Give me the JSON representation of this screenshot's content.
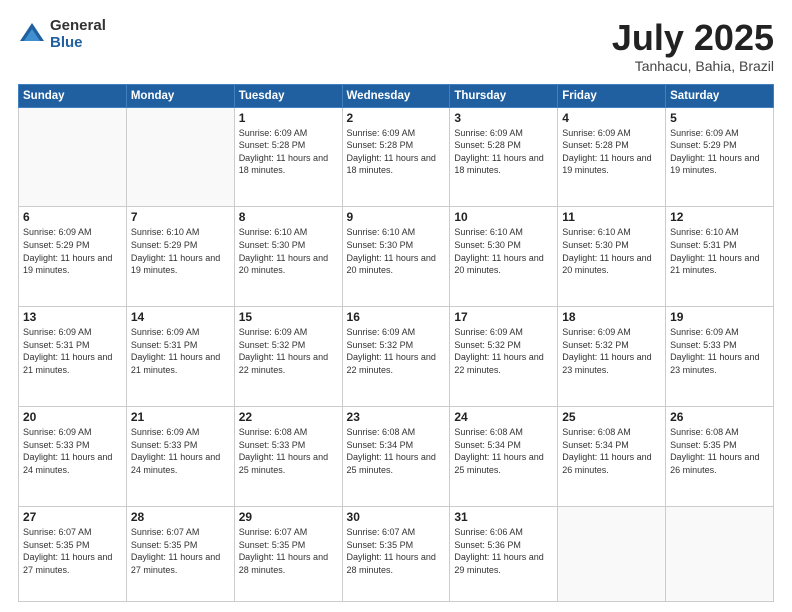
{
  "header": {
    "logo_general": "General",
    "logo_blue": "Blue",
    "month_title": "July 2025",
    "location": "Tanhacu, Bahia, Brazil"
  },
  "weekdays": [
    "Sunday",
    "Monday",
    "Tuesday",
    "Wednesday",
    "Thursday",
    "Friday",
    "Saturday"
  ],
  "weeks": [
    [
      {
        "day": "",
        "info": ""
      },
      {
        "day": "",
        "info": ""
      },
      {
        "day": "1",
        "info": "Sunrise: 6:09 AM\nSunset: 5:28 PM\nDaylight: 11 hours and 18 minutes."
      },
      {
        "day": "2",
        "info": "Sunrise: 6:09 AM\nSunset: 5:28 PM\nDaylight: 11 hours and 18 minutes."
      },
      {
        "day": "3",
        "info": "Sunrise: 6:09 AM\nSunset: 5:28 PM\nDaylight: 11 hours and 18 minutes."
      },
      {
        "day": "4",
        "info": "Sunrise: 6:09 AM\nSunset: 5:28 PM\nDaylight: 11 hours and 19 minutes."
      },
      {
        "day": "5",
        "info": "Sunrise: 6:09 AM\nSunset: 5:29 PM\nDaylight: 11 hours and 19 minutes."
      }
    ],
    [
      {
        "day": "6",
        "info": "Sunrise: 6:09 AM\nSunset: 5:29 PM\nDaylight: 11 hours and 19 minutes."
      },
      {
        "day": "7",
        "info": "Sunrise: 6:10 AM\nSunset: 5:29 PM\nDaylight: 11 hours and 19 minutes."
      },
      {
        "day": "8",
        "info": "Sunrise: 6:10 AM\nSunset: 5:30 PM\nDaylight: 11 hours and 20 minutes."
      },
      {
        "day": "9",
        "info": "Sunrise: 6:10 AM\nSunset: 5:30 PM\nDaylight: 11 hours and 20 minutes."
      },
      {
        "day": "10",
        "info": "Sunrise: 6:10 AM\nSunset: 5:30 PM\nDaylight: 11 hours and 20 minutes."
      },
      {
        "day": "11",
        "info": "Sunrise: 6:10 AM\nSunset: 5:30 PM\nDaylight: 11 hours and 20 minutes."
      },
      {
        "day": "12",
        "info": "Sunrise: 6:10 AM\nSunset: 5:31 PM\nDaylight: 11 hours and 21 minutes."
      }
    ],
    [
      {
        "day": "13",
        "info": "Sunrise: 6:09 AM\nSunset: 5:31 PM\nDaylight: 11 hours and 21 minutes."
      },
      {
        "day": "14",
        "info": "Sunrise: 6:09 AM\nSunset: 5:31 PM\nDaylight: 11 hours and 21 minutes."
      },
      {
        "day": "15",
        "info": "Sunrise: 6:09 AM\nSunset: 5:32 PM\nDaylight: 11 hours and 22 minutes."
      },
      {
        "day": "16",
        "info": "Sunrise: 6:09 AM\nSunset: 5:32 PM\nDaylight: 11 hours and 22 minutes."
      },
      {
        "day": "17",
        "info": "Sunrise: 6:09 AM\nSunset: 5:32 PM\nDaylight: 11 hours and 22 minutes."
      },
      {
        "day": "18",
        "info": "Sunrise: 6:09 AM\nSunset: 5:32 PM\nDaylight: 11 hours and 23 minutes."
      },
      {
        "day": "19",
        "info": "Sunrise: 6:09 AM\nSunset: 5:33 PM\nDaylight: 11 hours and 23 minutes."
      }
    ],
    [
      {
        "day": "20",
        "info": "Sunrise: 6:09 AM\nSunset: 5:33 PM\nDaylight: 11 hours and 24 minutes."
      },
      {
        "day": "21",
        "info": "Sunrise: 6:09 AM\nSunset: 5:33 PM\nDaylight: 11 hours and 24 minutes."
      },
      {
        "day": "22",
        "info": "Sunrise: 6:08 AM\nSunset: 5:33 PM\nDaylight: 11 hours and 25 minutes."
      },
      {
        "day": "23",
        "info": "Sunrise: 6:08 AM\nSunset: 5:34 PM\nDaylight: 11 hours and 25 minutes."
      },
      {
        "day": "24",
        "info": "Sunrise: 6:08 AM\nSunset: 5:34 PM\nDaylight: 11 hours and 25 minutes."
      },
      {
        "day": "25",
        "info": "Sunrise: 6:08 AM\nSunset: 5:34 PM\nDaylight: 11 hours and 26 minutes."
      },
      {
        "day": "26",
        "info": "Sunrise: 6:08 AM\nSunset: 5:35 PM\nDaylight: 11 hours and 26 minutes."
      }
    ],
    [
      {
        "day": "27",
        "info": "Sunrise: 6:07 AM\nSunset: 5:35 PM\nDaylight: 11 hours and 27 minutes."
      },
      {
        "day": "28",
        "info": "Sunrise: 6:07 AM\nSunset: 5:35 PM\nDaylight: 11 hours and 27 minutes."
      },
      {
        "day": "29",
        "info": "Sunrise: 6:07 AM\nSunset: 5:35 PM\nDaylight: 11 hours and 28 minutes."
      },
      {
        "day": "30",
        "info": "Sunrise: 6:07 AM\nSunset: 5:35 PM\nDaylight: 11 hours and 28 minutes."
      },
      {
        "day": "31",
        "info": "Sunrise: 6:06 AM\nSunset: 5:36 PM\nDaylight: 11 hours and 29 minutes."
      },
      {
        "day": "",
        "info": ""
      },
      {
        "day": "",
        "info": ""
      }
    ]
  ]
}
